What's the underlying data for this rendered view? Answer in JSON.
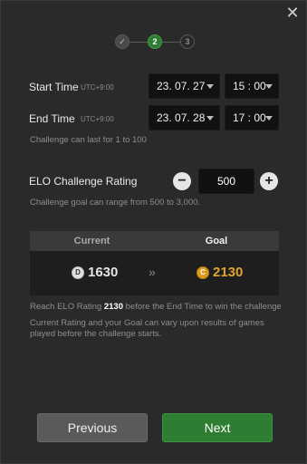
{
  "close_icon": "close-icon",
  "stepper": {
    "step1": "✓",
    "step2": "2",
    "step3": "3"
  },
  "start": {
    "label": "Start Time",
    "tz": "UTC+9:00",
    "date": "23. 07. 27",
    "time": "15 : 00"
  },
  "end": {
    "label": "End Time",
    "tz": "UTC+9:00",
    "date": "23. 07. 28",
    "time": "17 : 00"
  },
  "duration_hint": "Challenge can last for 1 to 100",
  "elo": {
    "label": "ELO Challenge Rating",
    "value": "500",
    "minus": "−",
    "plus": "+",
    "hint": "Challenge goal can range from 500 to 3,000."
  },
  "rating": {
    "current_header": "Current",
    "goal_header": "Goal",
    "current_badge": "D",
    "current_value": "1630",
    "arrows": "»",
    "goal_badge": "C",
    "goal_value": "2130"
  },
  "info": {
    "reach_prefix": "Reach ELO Rating ",
    "reach_value": "2130",
    "reach_suffix": " before the End Time to win the challenge",
    "note": "Current Rating and your Goal can vary upon results of games played before the challenge starts."
  },
  "buttons": {
    "previous": "Previous",
    "next": "Next"
  },
  "colors": {
    "accent_green": "#2e7d32",
    "goal_gold": "#e0a62a",
    "background": "#2a2a2a"
  }
}
